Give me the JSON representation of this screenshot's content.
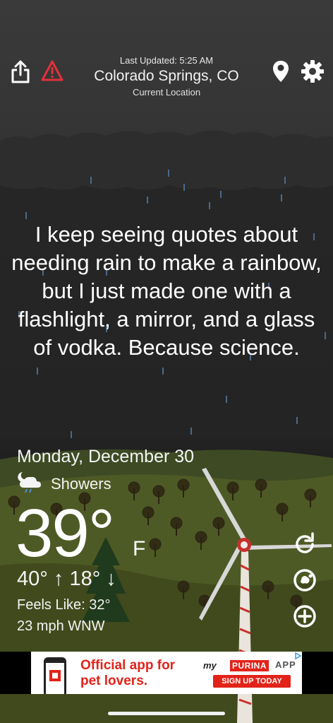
{
  "header": {
    "last_updated": "Last Updated: 5:25 AM",
    "location": "Colorado Springs, CO",
    "location_subtitle": "Current Location",
    "share_icon": "share-icon",
    "alert_icon": "warning-triangle-icon",
    "location_icon": "map-pin-icon",
    "settings_icon": "gear-icon"
  },
  "quote": "I keep seeing quotes about needing rain to make a rainbow, but I just made one with a flashlight, a mirror, and a glass of vodka. Because science.",
  "weather": {
    "date": "Monday, December 30",
    "condition": "Showers",
    "condition_icon": "night-cloud-rain-icon",
    "temperature": "39°",
    "unit": "F",
    "hi_lo": "40° ↑ 18° ↓",
    "feels_like": "Feels Like: 32°",
    "wind": "23 mph WNW"
  },
  "side_buttons": {
    "refresh_icon": "refresh-icon",
    "radar_icon": "radar-icon",
    "add_icon": "plus-circle-icon"
  },
  "ad": {
    "headline": "Official app for pet lovers.",
    "brand_prefix": "my",
    "brand": "PURINA",
    "app_label": "APP",
    "cta": "SIGN UP TODAY"
  },
  "colors": {
    "alert_red": "#e2313a",
    "ad_red": "#e2231a",
    "windmill_stripe": "#c8302c",
    "hill_green": "#4e5a25"
  }
}
